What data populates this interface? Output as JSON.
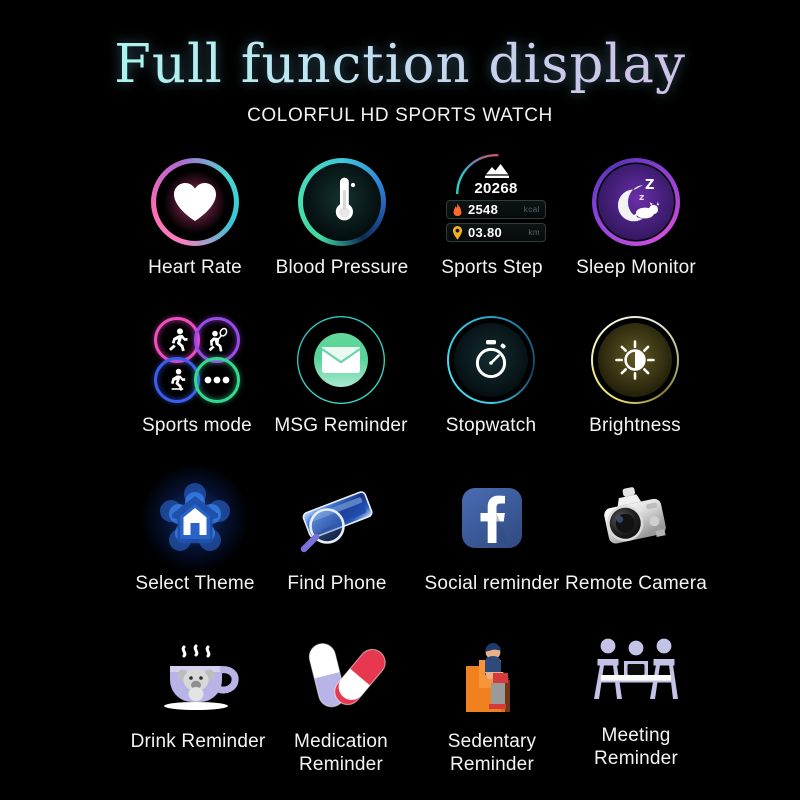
{
  "header": {
    "title": "Full function display",
    "subtitle": "COLORFUL HD SPORTS WATCH",
    "title_gradient_from": "#9ff0ee",
    "title_gradient_to": "#d2c2e9",
    "background": "#000000",
    "text_color": "#f4f4f4"
  },
  "sports_step_widget": {
    "steps": "20268",
    "calories": "2548",
    "distance": "03.80",
    "calories_unit": "kcal",
    "distance_unit": "km",
    "gauge_from_color": "#2fd6c0",
    "gauge_to_color": "#d8566e"
  },
  "features": [
    {
      "id": "heart-rate",
      "label": "Heart Rate",
      "icon": "heart-icon",
      "accent": "#ff7ec0",
      "row": 1,
      "col": 1
    },
    {
      "id": "blood-pressure",
      "label": "Blood Pressure",
      "icon": "thermometer-icon",
      "accent": "#3fd9a0",
      "row": 1,
      "col": 2
    },
    {
      "id": "sports-step",
      "label": "Sports Step",
      "icon": "step-gauge-icon",
      "accent": "#2fd6c0",
      "row": 1,
      "col": 3
    },
    {
      "id": "sleep-monitor",
      "label": "Sleep Monitor",
      "icon": "moon-sleep-icon",
      "accent": "#b04ae0",
      "row": 1,
      "col": 4
    },
    {
      "id": "sports-mode",
      "label": "Sports mode",
      "icon": "sports-quad-icon",
      "accent": "#f04ec0",
      "row": 2,
      "col": 1
    },
    {
      "id": "msg-reminder",
      "label": "MSG Reminder",
      "icon": "envelope-icon",
      "accent": "#35d6c6",
      "row": 2,
      "col": 2
    },
    {
      "id": "stopwatch",
      "label": "Stopwatch",
      "icon": "stopwatch-icon",
      "accent": "#3fd3e8",
      "row": 2,
      "col": 3
    },
    {
      "id": "brightness",
      "label": "Brightness",
      "icon": "brightness-sun-icon",
      "accent": "#e8e06a",
      "row": 2,
      "col": 4
    },
    {
      "id": "select-theme",
      "label": "Select Theme",
      "icon": "home-flower-icon",
      "accent": "#2d6eeb",
      "row": 3,
      "col": 1
    },
    {
      "id": "find-phone",
      "label": "Find Phone",
      "icon": "phone-magnifier-icon",
      "accent": "#2f5fd0",
      "row": 3,
      "col": 2
    },
    {
      "id": "social-reminder",
      "label": "Social reminder",
      "icon": "facebook-icon",
      "accent": "#3b5998",
      "row": 3,
      "col": 3
    },
    {
      "id": "remote-camera",
      "label": "Remote Camera",
      "icon": "dslr-camera-icon",
      "accent": "#dcdcdc",
      "row": 3,
      "col": 4
    },
    {
      "id": "drink-reminder",
      "label": "Drink Reminder",
      "icon": "teacup-koala-icon",
      "accent": "#b9b4e8",
      "row": 4,
      "col": 1
    },
    {
      "id": "medication-reminder",
      "label": "Medication Reminder",
      "icon": "pills-icon",
      "accent": "#e8384f",
      "row": 4,
      "col": 2
    },
    {
      "id": "sedentary-reminder",
      "label": "Sedentary Reminder",
      "icon": "person-armchair-icon",
      "accent": "#f57c20",
      "row": 4,
      "col": 3
    },
    {
      "id": "meeting-reminder",
      "label": "Meeting Reminder",
      "icon": "meeting-table-icon",
      "accent": "#c3c3e8",
      "row": 4,
      "col": 4
    }
  ]
}
